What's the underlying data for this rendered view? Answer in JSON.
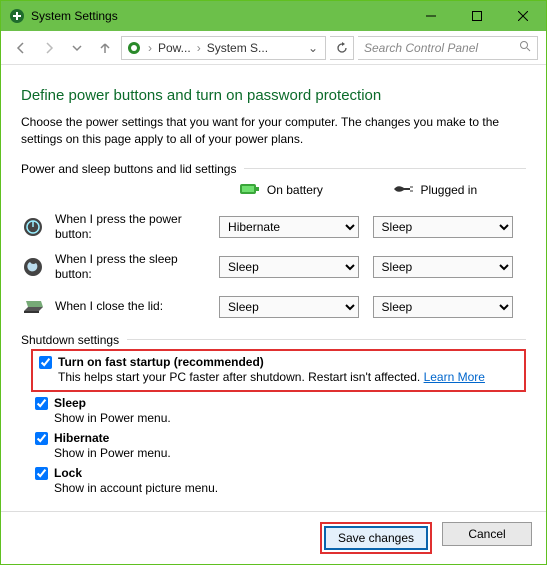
{
  "window": {
    "title": "System Settings"
  },
  "nav": {
    "crumb1": "Pow...",
    "crumb2": "System S..."
  },
  "search": {
    "placeholder": "Search Control Panel"
  },
  "page": {
    "title": "Define power buttons and turn on password protection",
    "description": "Choose the power settings that you want for your computer. The changes you make to the settings on this page apply to all of your power plans."
  },
  "section1": {
    "heading": "Power and sleep buttons and lid settings",
    "col_battery": "On battery",
    "col_plugged": "Plugged in",
    "rows": {
      "power_button": {
        "label": "When I press the power button:",
        "battery_value": "Hibernate",
        "plugged_value": "Sleep"
      },
      "sleep_button": {
        "label": "When I press the sleep button:",
        "battery_value": "Sleep",
        "plugged_value": "Sleep"
      },
      "close_lid": {
        "label": "When I close the lid:",
        "battery_value": "Sleep",
        "plugged_value": "Sleep"
      }
    }
  },
  "section2": {
    "heading": "Shutdown settings",
    "fast_startup": {
      "title": "Turn on fast startup (recommended)",
      "desc": "This helps start your PC faster after shutdown. Restart isn't affected.",
      "link": "Learn More"
    },
    "sleep": {
      "title": "Sleep",
      "desc": "Show in Power menu."
    },
    "hibernate": {
      "title": "Hibernate",
      "desc": "Show in Power menu."
    },
    "lock": {
      "title": "Lock",
      "desc": "Show in account picture menu."
    }
  },
  "footer": {
    "save": "Save changes",
    "cancel": "Cancel"
  }
}
